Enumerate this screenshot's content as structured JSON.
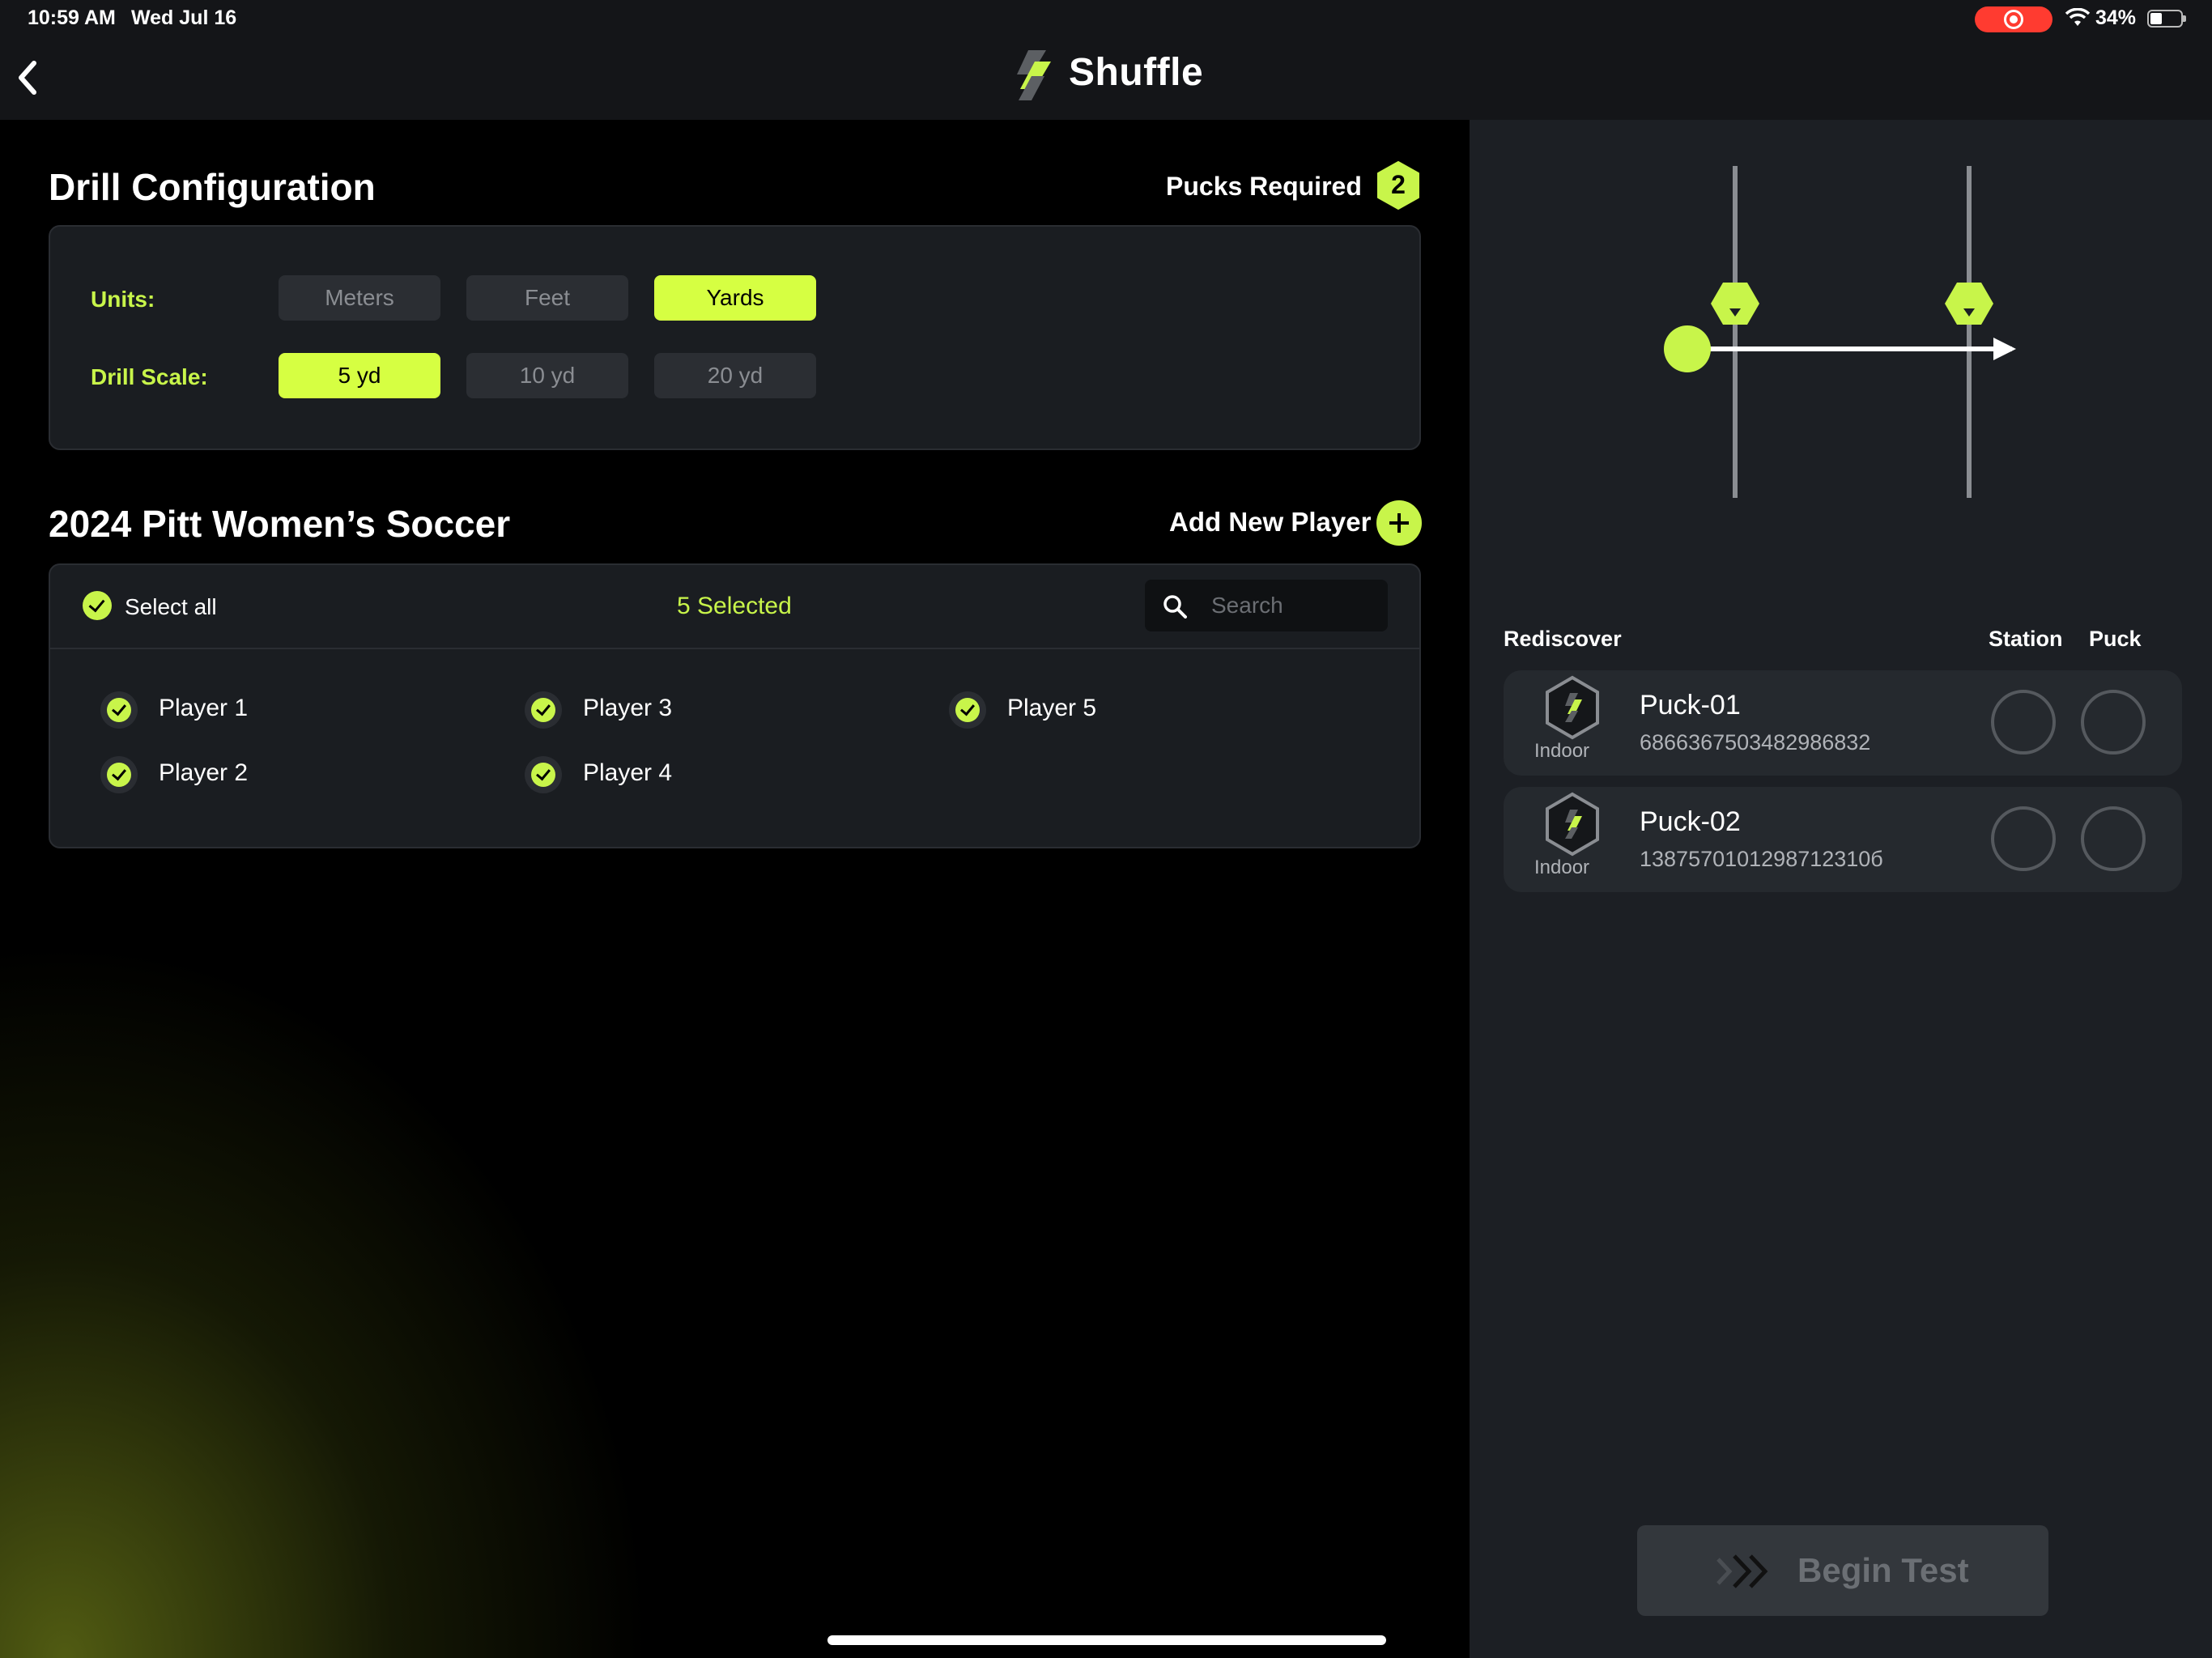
{
  "status_bar": {
    "time": "10:59 AM",
    "date": "Wed Jul 16",
    "battery": "34%"
  },
  "header": {
    "app_name": "Shuffle",
    "back_icon": "chevron-left-icon",
    "logo_icon": "shuffle-logo-icon"
  },
  "colors": {
    "accent": "#d6ff42",
    "panel": "#1a1d21",
    "right_panel": "#1c1f24"
  },
  "drill_config": {
    "title": "Drill Configuration",
    "pucks_required_label": "Pucks Required",
    "pucks_required_count": "2",
    "units_label": "Units:",
    "units_options": [
      "Meters",
      "Feet",
      "Yards"
    ],
    "units_selected": "Yards",
    "scale_label": "Drill Scale:",
    "scale_options": [
      "5 yd",
      "10 yd",
      "20 yd"
    ],
    "scale_selected": "5 yd"
  },
  "roster": {
    "title": "2024 Pitt Women’s Soccer",
    "add_player_label": "Add New Player",
    "select_all_label": "Select all",
    "selected_count_label": "5 Selected",
    "search_placeholder": "Search",
    "players": [
      "Player 1",
      "Player 2",
      "Player 3",
      "Player 4",
      "Player 5"
    ]
  },
  "pucks_panel": {
    "rediscover_label": "Rediscover",
    "station_label": "Station",
    "puck_label": "Puck",
    "pucks": [
      {
        "name": "Puck-01",
        "id": "6866367503482986832",
        "type": "Indoor"
      },
      {
        "name": "Puck-02",
        "id": "1387570101298712310б",
        "type": "Indoor"
      }
    ]
  },
  "begin_test_label": "Begin Test"
}
